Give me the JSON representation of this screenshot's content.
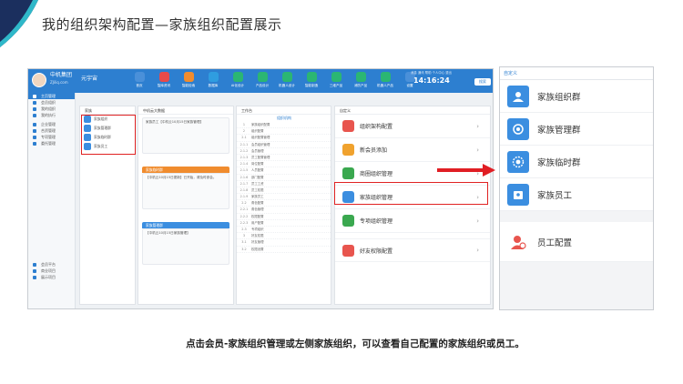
{
  "slide": {
    "title": "我的组织架构配置—家族组织配置展示",
    "caption": "点击会员-家族组织管理或左侧家族组织，可以查看自己配置的家族组织或员工。"
  },
  "app": {
    "brand": "中机集团",
    "brand_sub": "ZJiliq.com",
    "user": "元宇宙",
    "clock": "14:16:24",
    "search_label": "搜索",
    "top_links": "消息 通讯 帮助 个人中心 退出",
    "accent": "#2d7fd0",
    "nav": [
      {
        "label": "首页",
        "color": "#4a90d9"
      },
      {
        "label": "智库资讯",
        "color": "#e84a4a"
      },
      {
        "label": "智能检索",
        "color": "#f08c2e"
      },
      {
        "label": "数据库",
        "color": "#2f9de0"
      },
      {
        "label": "AI化设计",
        "color": "#2bb673"
      },
      {
        "label": "产品设计",
        "color": "#2bb673"
      },
      {
        "label": "机器人设计",
        "color": "#2bb673"
      },
      {
        "label": "智能制造",
        "color": "#2bb673"
      },
      {
        "label": "三维产品",
        "color": "#2bb673"
      },
      {
        "label": "消防产品",
        "color": "#2bb673"
      },
      {
        "label": "机器人产品",
        "color": "#2bb673"
      },
      {
        "label": "设置",
        "color": "#4a90d9"
      }
    ]
  },
  "leftnav": {
    "items": [
      "主页管理",
      "会员组织",
      "我的组织",
      "我的执行",
      "企业管理",
      "合资管理",
      "专项管理",
      "委托管理"
    ],
    "bottom": [
      "会员平台",
      "商业项目",
      "展示项目"
    ]
  },
  "family_panel": {
    "header": "家族",
    "items": [
      "家族组织",
      "家族管理群",
      "家族临时群",
      "家族员工"
    ]
  },
  "chat_panel": {
    "header": "中机云大数据",
    "cards": [
      {
        "head": "",
        "text": "家族员工【中机云10月15日家族管理】"
      },
      {
        "head": "家族临时群",
        "text": "【中机云10月15日更新】已开始，请及时参会。"
      },
      {
        "head": "家族管理群",
        "text": "【中机云10月15日家族管理】"
      }
    ]
  },
  "tree_panel": {
    "header": "工作台",
    "title": "组织机构",
    "rows": [
      {
        "n": "1",
        "t": "家族组织配置"
      },
      {
        "n": "2",
        "t": "组织配置"
      },
      {
        "n": "2.1",
        "t": "组织配置管理"
      },
      {
        "n": "2.1.1",
        "t": "会员组织管理"
      },
      {
        "n": "2.1.2",
        "t": "会员管理"
      },
      {
        "n": "2.1.3",
        "t": "员工配置管理"
      },
      {
        "n": "2.1.4",
        "t": "岗位配置"
      },
      {
        "n": "2.1.5",
        "t": "人员配置"
      },
      {
        "n": "2.1.6",
        "t": "部门配置"
      },
      {
        "n": "2.1.7",
        "t": "员工工资"
      },
      {
        "n": "2.1.8",
        "t": "员工权限"
      },
      {
        "n": "2.1.9",
        "t": "家族员工"
      },
      {
        "n": "2.2",
        "t": "角色配置"
      },
      {
        "n": "2.2.1",
        "t": "角色管理"
      },
      {
        "n": "2.2.2",
        "t": "权限配置"
      },
      {
        "n": "2.2.3",
        "t": "用户配置"
      },
      {
        "n": "2.3",
        "t": "专项组织"
      },
      {
        "n": "3",
        "t": "好友权限"
      },
      {
        "n": "3.1",
        "t": "好友管理"
      },
      {
        "n": "3.2",
        "t": "权限设置"
      }
    ]
  },
  "member_menu": {
    "items": [
      {
        "label": "组织架构配置",
        "color": "#e8554e"
      },
      {
        "label": "新会员添加",
        "color": "#f0a22e"
      },
      {
        "label": "商圈组织管理",
        "color": "#3aa84f"
      },
      {
        "label": "家族组织管理",
        "color": "#3b8ee0"
      },
      {
        "label": "专项组织管理",
        "color": "#3aa84f"
      },
      {
        "label": "好友权限配置",
        "color": "#e8554e"
      }
    ]
  },
  "popup": {
    "header": "自定义",
    "items": [
      "家族组织群",
      "家族管理群",
      "家族临时群",
      "家族员工"
    ],
    "staff_label": "员工配置"
  }
}
